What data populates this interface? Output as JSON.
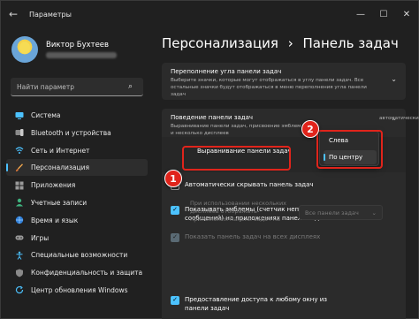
{
  "window": {
    "title": "Параметры",
    "back_icon": "arrow-left-icon",
    "minimize": "—",
    "maximize": "☐",
    "close": "✕"
  },
  "profile": {
    "name": "Виктор Бухтеев"
  },
  "search": {
    "placeholder": "Найти параметр",
    "icon": "search-icon"
  },
  "nav": [
    {
      "label": "Система",
      "icon": "monitor-icon",
      "active": false
    },
    {
      "label": "Bluetooth и устройства",
      "icon": "bluetooth-icon",
      "active": false
    },
    {
      "label": "Сеть и Интернет",
      "icon": "wifi-icon",
      "active": false
    },
    {
      "label": "Персонализация",
      "icon": "brush-icon",
      "active": true
    },
    {
      "label": "Приложения",
      "icon": "apps-icon",
      "active": false
    },
    {
      "label": "Учетные записи",
      "icon": "person-icon",
      "active": false
    },
    {
      "label": "Время и язык",
      "icon": "globe-icon",
      "active": false
    },
    {
      "label": "Игры",
      "icon": "gamepad-icon",
      "active": false
    },
    {
      "label": "Специальные возможности",
      "icon": "accessibility-icon",
      "active": false
    },
    {
      "label": "Конфиденциальность и защита",
      "icon": "shield-icon",
      "active": false
    },
    {
      "label": "Центр обновления Windows",
      "icon": "update-icon",
      "active": false
    }
  ],
  "page": {
    "breadcrumb_parent": "Персонализация",
    "separator": "›",
    "breadcrumb_current": "Панель задач"
  },
  "overflow_card": {
    "title": "Переполнение угла панели задач",
    "desc": "Выберите значки, которые могут отображаться в углу панели задач. Все остальные значки будут отображаться в меню переполнения угла панели задач"
  },
  "behavior_card": {
    "title": "Поведение панели задач",
    "desc": "Выравнивание панели задач, присвоение эмблем",
    "desc_line2": "и несколько дисплеев",
    "desc_overflow": "автоматически"
  },
  "alignment": {
    "label": "Выравнивание панели задач",
    "options": [
      "Слева",
      "По центру"
    ],
    "selected": "По центру"
  },
  "options": {
    "autohide": "Автоматически скрывать панель задач",
    "badges": "Показывать эмблемы (счетчик непрочитанных сообщений) на приложениях панели задач",
    "all_displays": "Показать панель задач на всех дисплеях",
    "multi_label": "При использовании нескольких дисплеев отображать приложения панели задач на",
    "multi_value": "Все панели задач",
    "share_window": "Предоставление доступа к любому окну из панели задач"
  },
  "annotations": {
    "badge_1": "1",
    "badge_2": "2",
    "highlight_color": "#e0241b"
  },
  "colors": {
    "accent": "#4cc2ff",
    "background": "#202020",
    "card": "#2b2b2b"
  }
}
